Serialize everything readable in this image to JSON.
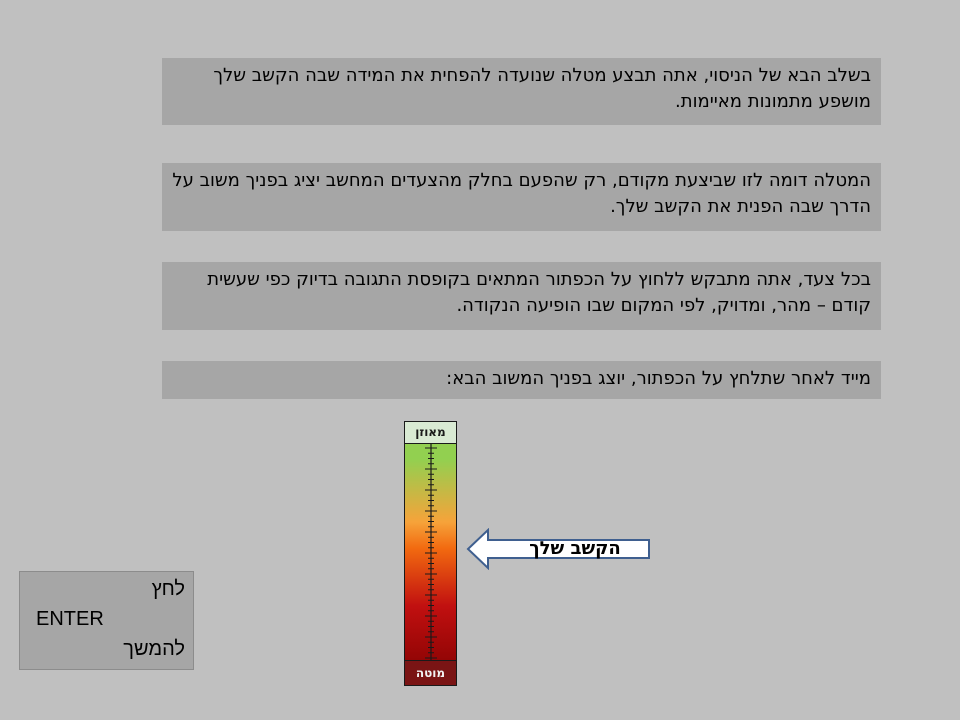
{
  "instructions": [
    "בשלב הבא של הניסוי, אתה תבצע מטלה שנועדה להפחית את המידה שבה הקשב שלך מושפע מתמונות מאיימות.",
    "המטלה דומה לזו שביצעת מקודם, רק שהפעם בחלק מהצעדים המחשב יציג בפניך משוב על הדרך שבה הפנית את הקשב שלך.",
    "בכל צעד, אתה מתבקש ללחוץ על הכפתור המתאים בקופסת התגובה בדיוק כפי שעשית קודם – מהר, ומדויק, לפי המקום שבו הופיעה הנקודה.",
    "מייד לאחר שתלחץ על הכפתור, יוצג בפניך המשוב הבא:"
  ],
  "gauge": {
    "top_label": "מאוזן",
    "bottom_label": "מוטה",
    "colors": {
      "top": "#92d050",
      "middle": "#f26a10",
      "bottom": "#7f0000"
    }
  },
  "pointer": {
    "label": "הקשב שלך",
    "icon": "left-arrow-icon"
  },
  "continue": {
    "line1": "לחץ",
    "line2": "ENTER",
    "line3": "להמשך"
  }
}
